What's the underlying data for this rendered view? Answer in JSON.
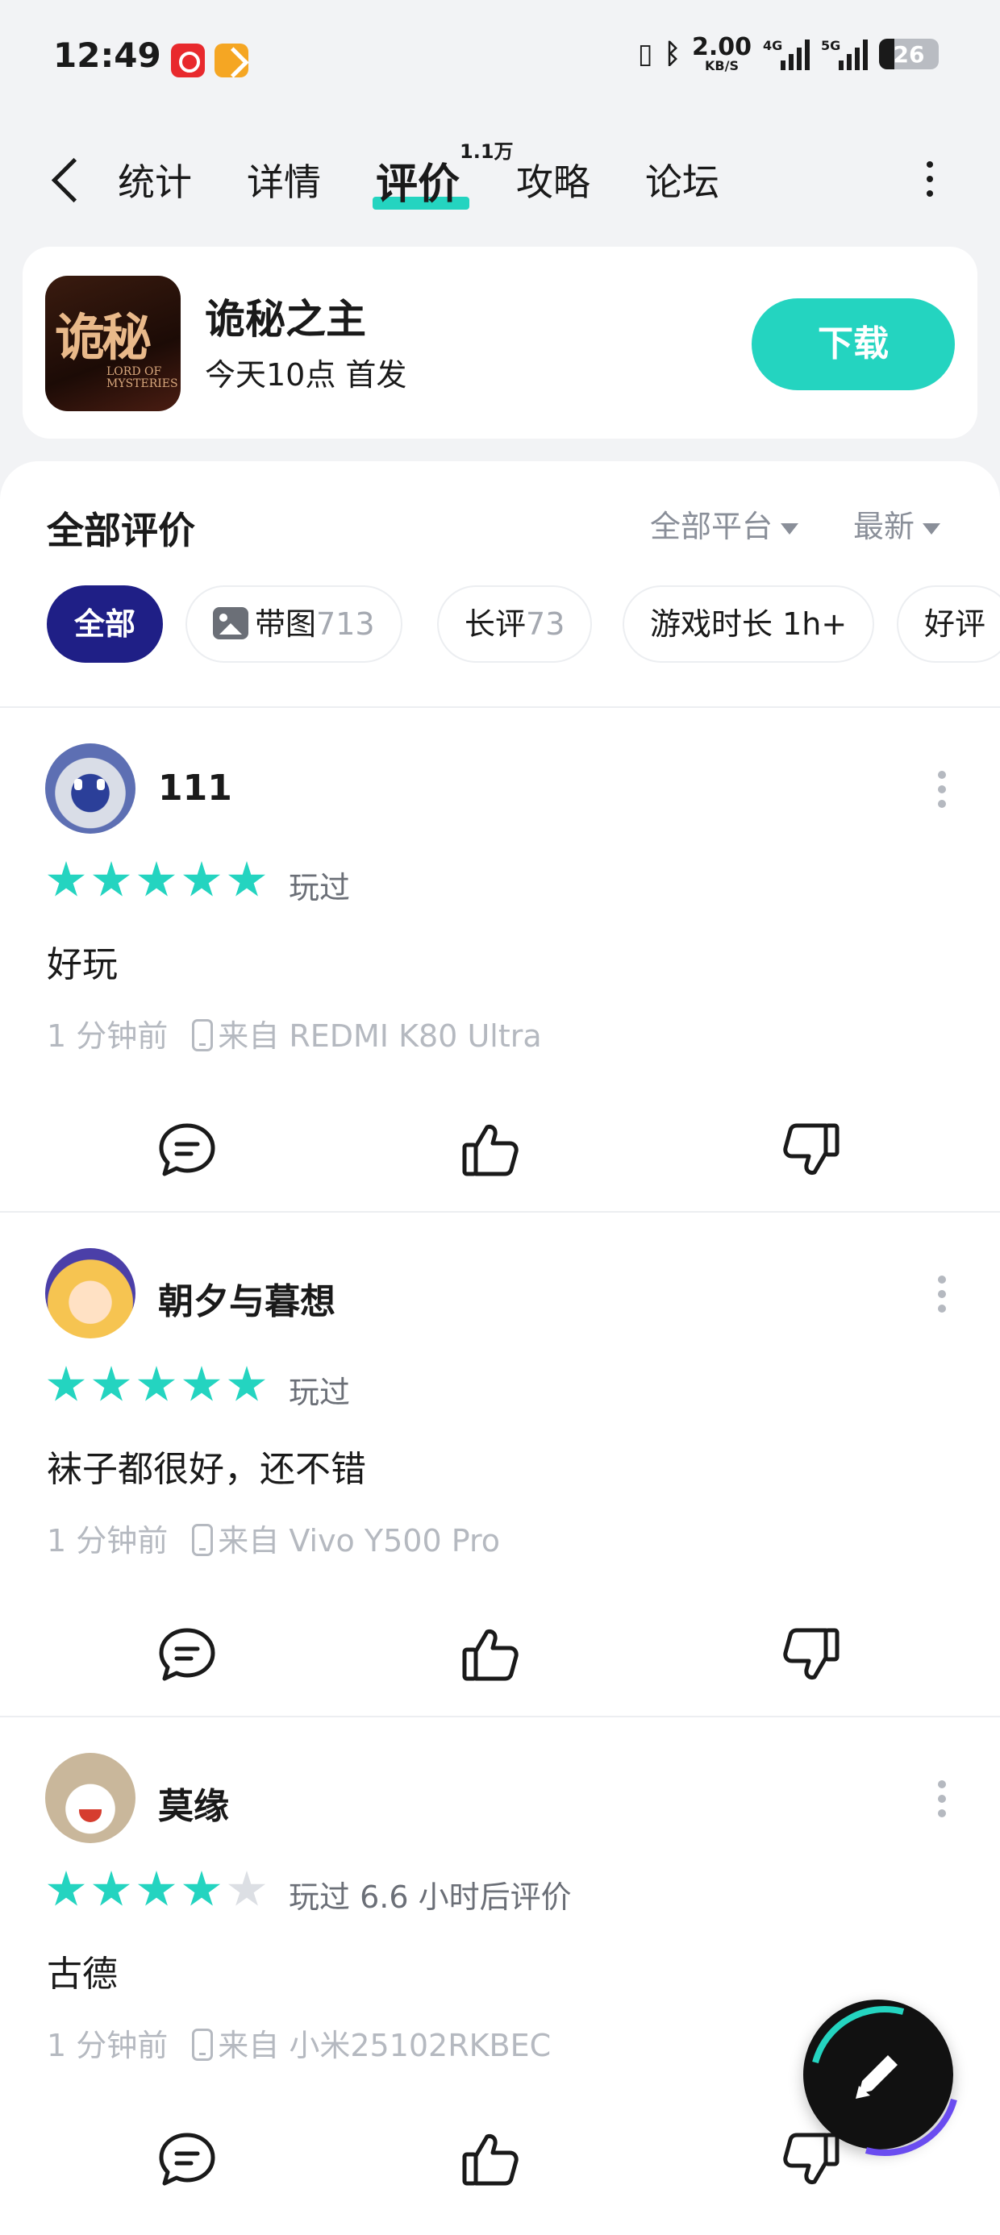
{
  "status_bar": {
    "time": "12:49",
    "net_speed_value": "2.00",
    "net_speed_unit": "KB/S",
    "signal_1_label": "4G",
    "signal_2_label": "5G",
    "battery": "26",
    "battery_level": 0.26
  },
  "nav": {
    "tabs": [
      {
        "label": "统计"
      },
      {
        "label": "详情"
      },
      {
        "label": "评价"
      },
      {
        "label": "攻略"
      },
      {
        "label": "论坛"
      }
    ],
    "active_tab": "评价",
    "review_count": "1.1万"
  },
  "game": {
    "icon_title": "诡秘",
    "icon_subtitle": "LORD OF MYSTERIES",
    "name": "诡秘之主",
    "subtitle": "今天10点 首发",
    "download_label": "下载"
  },
  "reviews_section": {
    "title": "全部评价",
    "platform_filter": "全部平台",
    "sort_filter": "最新",
    "chips": [
      {
        "label": "全部",
        "count": ""
      },
      {
        "label": "带图",
        "count": "713"
      },
      {
        "label": "长评",
        "count": "73"
      },
      {
        "label": "游戏时长 1h+",
        "count": ""
      },
      {
        "label": "好评",
        "count": ""
      }
    ]
  },
  "reviews": [
    {
      "user": "111",
      "rating": 5,
      "played": "玩过",
      "content": "好玩",
      "time": "1 分钟前",
      "device": "来自 REDMI K80 Ultra"
    },
    {
      "user": "朝夕与暮想",
      "rating": 5,
      "played": "玩过",
      "content": "袜子都很好，还不错",
      "time": "1 分钟前",
      "device": "来自 Vivo Y500 Pro"
    },
    {
      "user": "莫缘",
      "rating": 4,
      "played": "玩过 6.6 小时后评价",
      "content": "古德",
      "time": "1 分钟前",
      "device": "来自 小米25102RKBEC"
    }
  ],
  "colors": {
    "accent": "#24d4c0",
    "active_chip": "#1f1f86",
    "muted_text": "#b5b9c0"
  },
  "icons": [
    "back-arrow-icon",
    "more-vertical-icon",
    "comment-icon",
    "thumbs-up-icon",
    "thumbs-down-icon",
    "image-icon",
    "phone-icon",
    "pen-icon",
    "caret-down-icon",
    "star-icon"
  ]
}
